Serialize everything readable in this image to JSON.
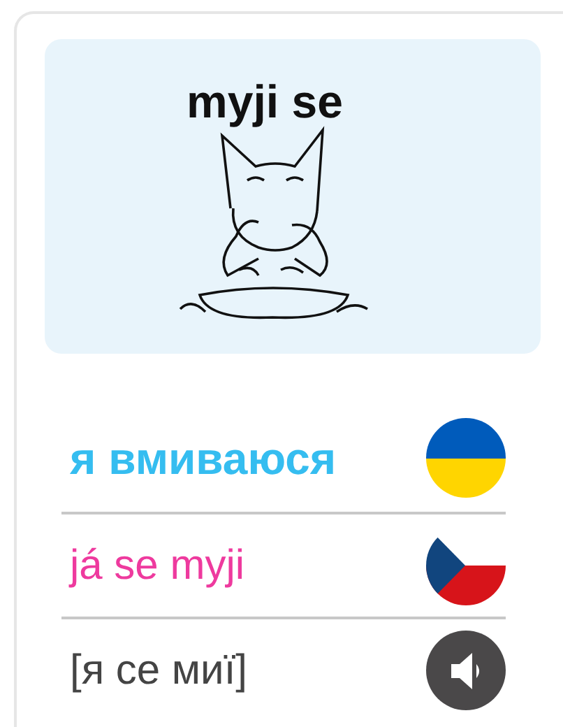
{
  "illustration": {
    "caption": "myji se"
  },
  "rows": [
    {
      "text": "я вмиваюся",
      "kind": "ukrainian",
      "color": "#35bdf0"
    },
    {
      "text": "já se myji",
      "kind": "czech",
      "color": "#ee3a9e"
    },
    {
      "text": "[я се миї]",
      "kind": "audio",
      "color": "#444444"
    }
  ]
}
